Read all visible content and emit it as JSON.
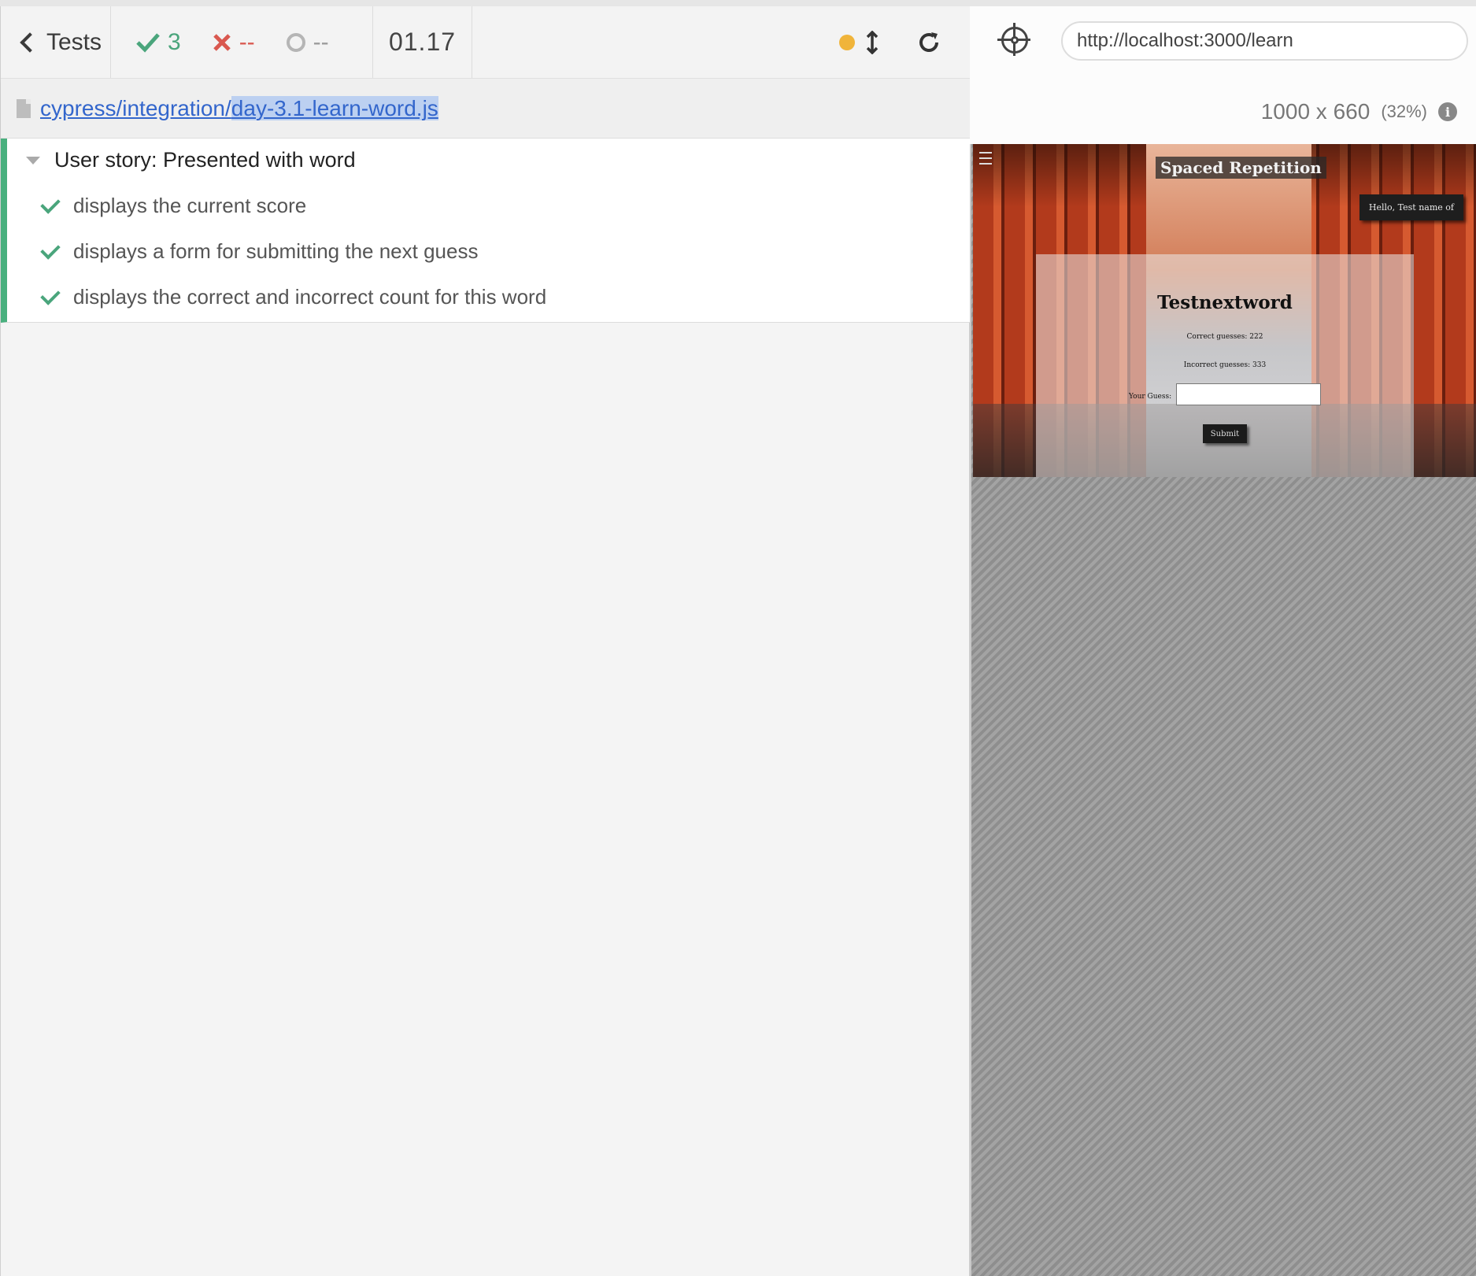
{
  "header": {
    "tests_label": "Tests",
    "passed": "3",
    "failed": "--",
    "pending": "--",
    "duration": "01.17"
  },
  "file": {
    "path_prefix": "cypress/integration/",
    "filename": "day-3.1-learn-word.js"
  },
  "suite": {
    "title": "User story: Presented with word",
    "tests": [
      "displays the current score",
      "displays a form for submitting the next guess",
      "displays the correct and incorrect count for this word"
    ]
  },
  "aut": {
    "url": "http://localhost:3000/learn",
    "viewport_size": "1000 x 660",
    "scale": "(32%)",
    "app": {
      "title": "Spaced Repetition",
      "greeting": "Hello, Test name of",
      "word": "Testnextword",
      "correct": "Correct guesses: 222",
      "incorrect": "Incorrect guesses: 333",
      "guess_label": "Your Guess:",
      "submit_label": "Submit"
    }
  },
  "colors": {
    "pass": "#4aa57c",
    "fail": "#d9584f",
    "running_dot": "#f0b43a",
    "link": "#3366cc"
  },
  "icons": [
    "chevron-left-icon",
    "check-icon",
    "x-icon",
    "spinner-icon",
    "status-dot-icon",
    "resize-vertical-icon",
    "reload-icon",
    "file-icon",
    "caret-down-icon",
    "crosshair-icon",
    "info-icon",
    "hamburger-icon"
  ]
}
